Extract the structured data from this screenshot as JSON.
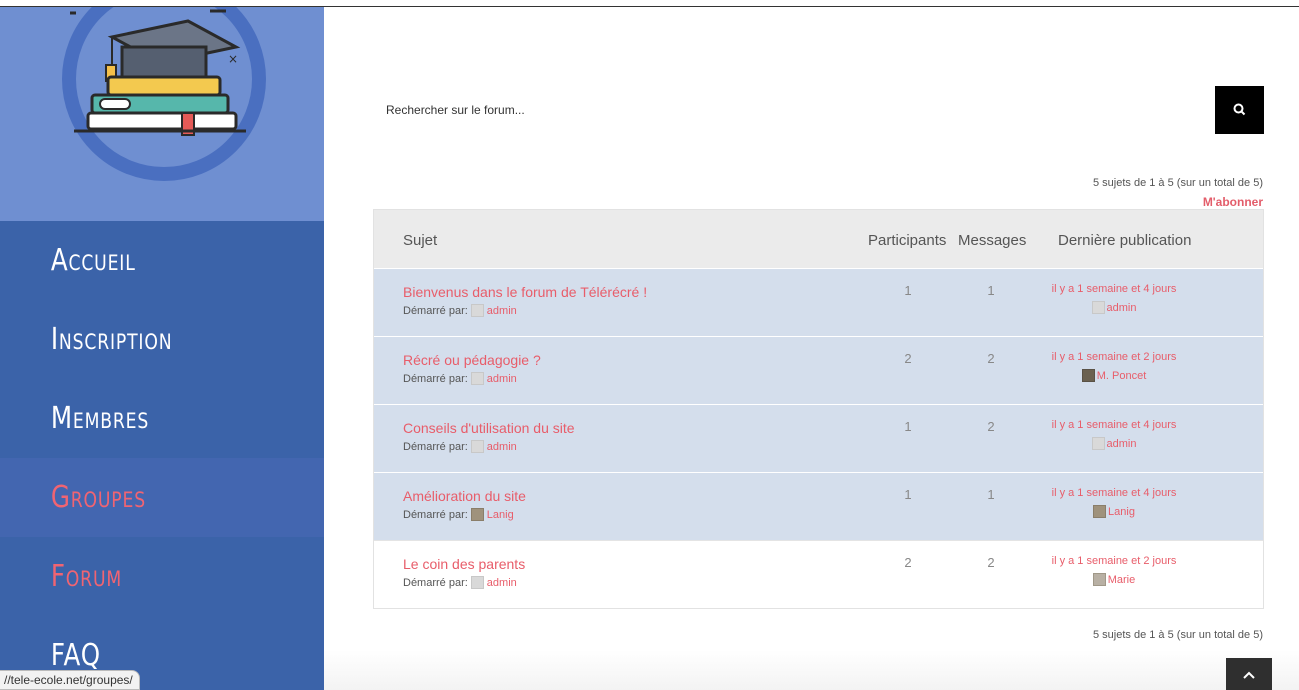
{
  "sidebar": {
    "nav": [
      {
        "label": "Accueil"
      },
      {
        "label": "Inscription"
      },
      {
        "label": "Membres"
      },
      {
        "label": "Groupes"
      },
      {
        "label": "Forum"
      },
      {
        "label": "FAQ"
      }
    ],
    "url_tooltip": "//tele-ecole.net/groupes/"
  },
  "search": {
    "placeholder": "Rechercher sur le forum...",
    "button_icon": "search-icon"
  },
  "pagination": {
    "top": "5 sujets de 1 à 5 (sur un total de 5)",
    "bottom": "5 sujets de 1 à 5 (sur un total de 5)"
  },
  "subscribe_label": "M'abonner",
  "table": {
    "headers": {
      "topic": "Sujet",
      "participants": "Participants",
      "messages": "Messages",
      "last": "Dernière publication"
    },
    "started_by_label": "Démarré par:",
    "rows": [
      {
        "title": "Bienvenus dans le forum de Télérécré !",
        "author": "admin",
        "participants": "1",
        "messages": "1",
        "freshness": "il y a 1 semaine et 4 jours",
        "last_author": "admin"
      },
      {
        "title": "Récré ou pédagogie ?",
        "author": "admin",
        "participants": "2",
        "messages": "2",
        "freshness": "il y a 1 semaine et 2 jours",
        "last_author": "M. Poncet"
      },
      {
        "title": "Conseils d'utilisation du site",
        "author": "admin",
        "participants": "1",
        "messages": "2",
        "freshness": "il y a 1 semaine et 4 jours",
        "last_author": "admin"
      },
      {
        "title": "Amélioration du site",
        "author": "Lanig",
        "participants": "1",
        "messages": "1",
        "freshness": "il y a 1 semaine et 4 jours",
        "last_author": "Lanig"
      },
      {
        "title": "Le coin des parents",
        "author": "admin",
        "participants": "2",
        "messages": "2",
        "freshness": "il y a 1 semaine et 2 jours",
        "last_author": "Marie"
      }
    ]
  },
  "colors": {
    "sidebar": "#3b63a9",
    "logo_bg": "#6f8fd1",
    "accent": "#e85d6a",
    "row_shade": "#d4deec"
  }
}
